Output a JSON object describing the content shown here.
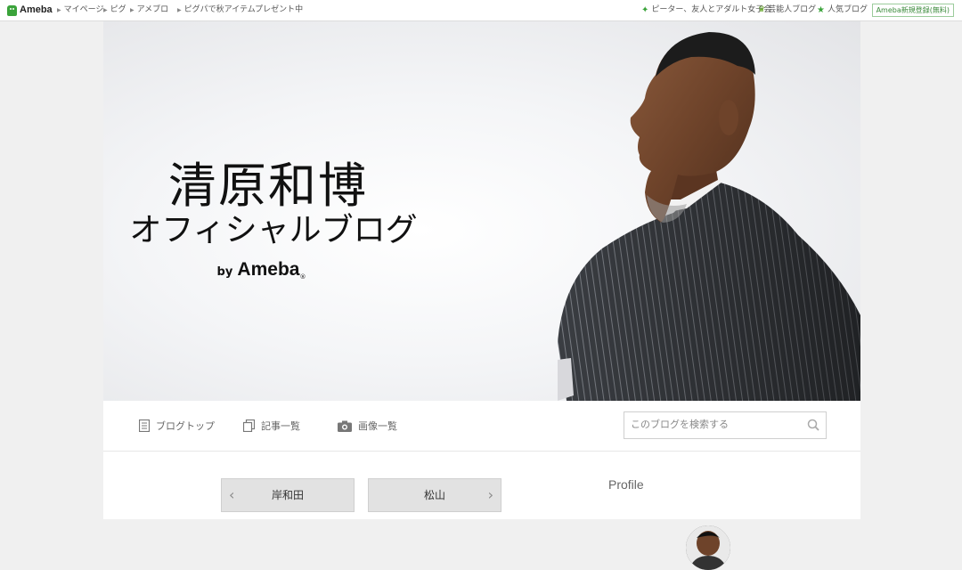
{
  "topbar": {
    "logo_text": "Ameba",
    "links": [
      {
        "label": "マイページ"
      },
      {
        "label": "ピグ"
      },
      {
        "label": "アメブロ"
      },
      {
        "label": "ピグパで秋アイテムプレゼント中"
      }
    ],
    "right_links": [
      {
        "label": "ピーター、友人とアダルト女子会",
        "icon": "sparkle-icon"
      },
      {
        "label": "芸能人ブログ",
        "icon": "crown-icon"
      },
      {
        "label": "人気ブログ",
        "icon": "star-icon"
      }
    ],
    "register_label": "Ameba新規登録(無料)"
  },
  "header": {
    "title": "清原和博",
    "subtitle": "オフィシャルブログ",
    "by": "by",
    "brand": "Ameba",
    "brand_mark": "®"
  },
  "blognav": {
    "items": [
      {
        "label": "ブログトップ",
        "icon": "document-icon"
      },
      {
        "label": "記事一覧",
        "icon": "copy-icon"
      },
      {
        "label": "画像一覧",
        "icon": "camera-icon"
      }
    ],
    "search_placeholder": "このブログを検索する"
  },
  "pager": {
    "prev_label": "岸和田",
    "next_label": "松山"
  },
  "sidebar": {
    "profile_heading": "Profile"
  },
  "colors": {
    "accent_green": "#3aa33a",
    "nav_text": "#666666",
    "pager_bg": "#e2e2e2"
  }
}
